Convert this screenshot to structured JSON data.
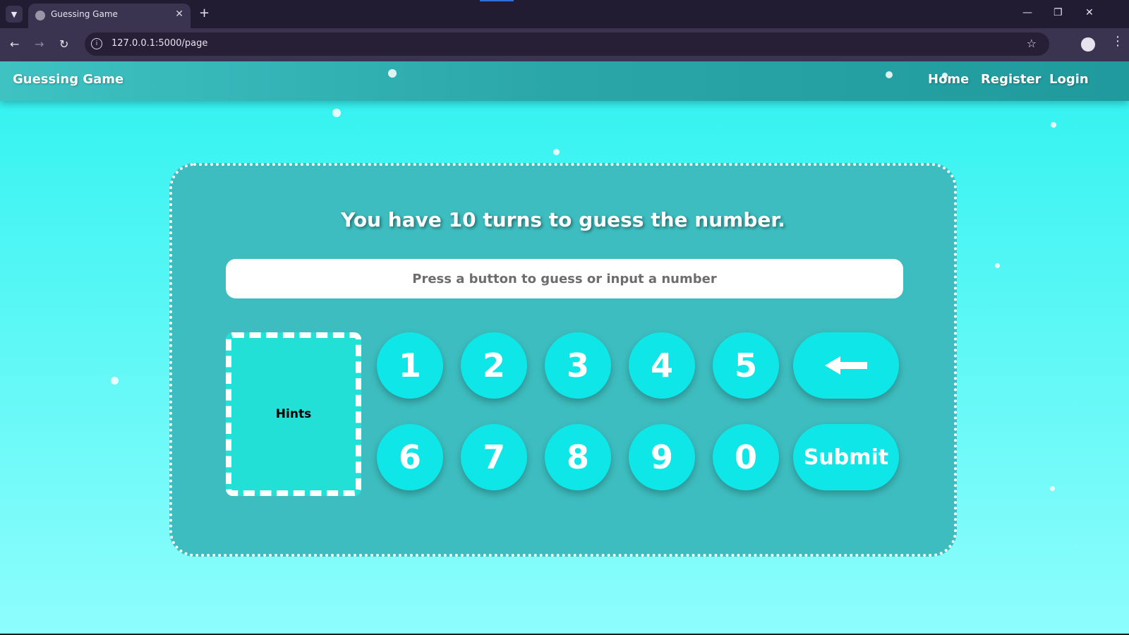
{
  "browser": {
    "tab_title": "Guessing Game",
    "url": "127.0.0.1:5000/page"
  },
  "nav": {
    "brand": "Guessing Game",
    "links": [
      "Home",
      "Register",
      "Login"
    ]
  },
  "game": {
    "headline": "You have 10 turns to guess the number.",
    "input_placeholder": "Press a button to guess or input a number",
    "input_value": "",
    "hints_label": "Hints",
    "keys_row1": [
      "1",
      "2",
      "3",
      "4",
      "5"
    ],
    "keys_row2": [
      "6",
      "7",
      "8",
      "9",
      "0"
    ],
    "backspace_icon": "left-arrow-icon",
    "submit_label": "Submit"
  },
  "colors": {
    "navbar": "#2aa6a8",
    "card": "#3dbdbf",
    "key": "#0fe6e8",
    "hints": "#22e0d5",
    "page_top": "#2ff2f0",
    "page_bottom": "#8dfdfd"
  }
}
